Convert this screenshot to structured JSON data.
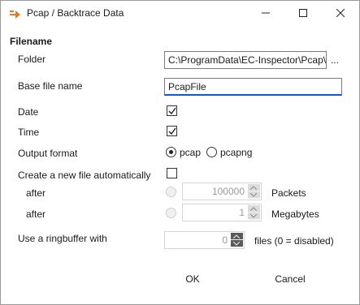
{
  "window": {
    "title": "Pcap / Backtrace Data"
  },
  "section": {
    "title": "Filename"
  },
  "fields": {
    "folder_label": "Folder",
    "folder_value": "C:\\ProgramData\\EC-Inspector\\Pcap\\",
    "browse_label": "...",
    "basename_label": "Base file name",
    "basename_value": "PcapFile",
    "date_label": "Date",
    "date_checked": true,
    "time_label": "Time",
    "time_checked": true,
    "output_format_label": "Output format",
    "format_options": [
      {
        "label": "pcap",
        "selected": true
      },
      {
        "label": "pcapng",
        "selected": false
      }
    ],
    "new_file_label": "Create a new file automatically",
    "new_file_checked": false,
    "after_packets_label": "after",
    "packets_value": "100000",
    "packets_unit": "Packets",
    "after_mb_label": "after",
    "mb_value": "1",
    "mb_unit": "Megabytes",
    "ringbuffer_label": "Use a ringbuffer with",
    "ringbuffer_value": "0",
    "ringbuffer_unit": "files (0 = disabled)"
  },
  "buttons": {
    "ok": "OK",
    "cancel": "Cancel"
  }
}
